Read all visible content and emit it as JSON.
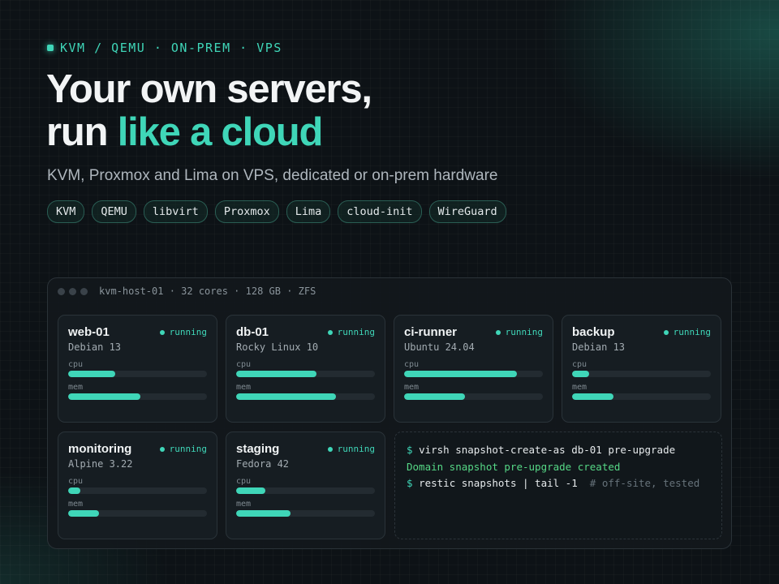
{
  "eyebrow": "KVM / QEMU · ON-PREM · VPS",
  "headline": {
    "line1": "Your own servers,",
    "line2_plain": "run ",
    "line2_accent": "like a cloud"
  },
  "subtitle": "KVM, Proxmox and Lima on VPS, dedicated or on-prem hardware",
  "tags": [
    "KVM",
    "QEMU",
    "libvirt",
    "Proxmox",
    "Lima",
    "cloud-init",
    "WireGuard"
  ],
  "panel": {
    "host": "kvm-host-01 · 32 cores · 128 GB · ZFS",
    "cpu_label": "cpu",
    "mem_label": "mem",
    "vms": [
      {
        "name": "web-01",
        "os": "Debian 13",
        "status": "running",
        "cpu": 0.34,
        "mem": 0.52
      },
      {
        "name": "db-01",
        "os": "Rocky Linux 10",
        "status": "running",
        "cpu": 0.58,
        "mem": 0.72
      },
      {
        "name": "ci-runner",
        "os": "Ubuntu 24.04",
        "status": "running",
        "cpu": 0.81,
        "mem": 0.44
      },
      {
        "name": "backup",
        "os": "Debian 13",
        "status": "running",
        "cpu": 0.12,
        "mem": 0.3
      },
      {
        "name": "monitoring",
        "os": "Alpine 3.22",
        "status": "running",
        "cpu": 0.09,
        "mem": 0.22
      },
      {
        "name": "staging",
        "os": "Fedora 42",
        "status": "running",
        "cpu": 0.21,
        "mem": 0.39
      }
    ],
    "terminal": {
      "prompt": "$",
      "cmd1": "virsh snapshot-create-as db-01 pre-upgrade",
      "output1": "Domain snapshot pre-upgrade created",
      "cmd2": "restic snapshots | tail -1",
      "comment2": "# off-site, tested"
    }
  },
  "colors": {
    "accent": "#3fd6b8",
    "background": "#0d1216",
    "success": "#56d886"
  }
}
